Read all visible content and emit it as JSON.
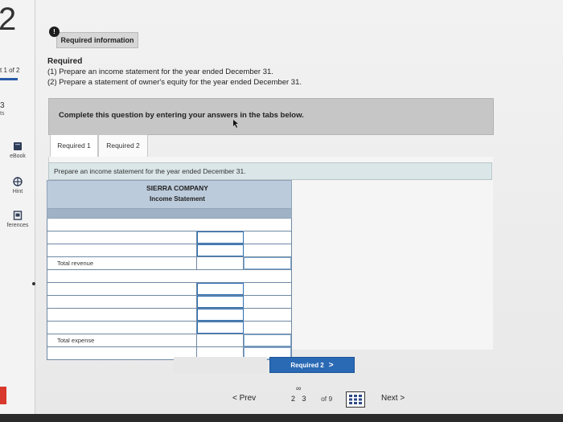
{
  "sidebar": {
    "question_number": "2",
    "part_label": "t 1 of 2",
    "points_value": "3",
    "points_label": "ts",
    "tools": [
      {
        "label": "eBook",
        "icon": "book-icon"
      },
      {
        "label": "Hint",
        "icon": "globe-icon"
      },
      {
        "label": "ferences",
        "icon": "reference-icon"
      }
    ]
  },
  "required_info": {
    "badge": "!",
    "label": "Required information"
  },
  "required": {
    "heading": "Required",
    "lines": [
      "(1) Prepare an income statement for the year ended December 31.",
      "(2) Prepare a statement of owner's equity for the year ended December 31."
    ]
  },
  "instruction": "Complete this question by entering your answers in the tabs below.",
  "tabs": [
    {
      "label": "Required 1",
      "active": true
    },
    {
      "label": "Required 2",
      "active": false
    }
  ],
  "tab_panel": {
    "prompt": "Prepare an income statement for the year ended December 31."
  },
  "statement": {
    "company": "SIERRA COMPANY",
    "title": "Income Statement",
    "total_revenue_label": "Total revenue",
    "total_expense_label": "Total expense"
  },
  "navigation": {
    "next_tab_label": "Required 2",
    "next_tab_chevron": ">",
    "prev_label": "Prev",
    "prev_chevron": "<",
    "pages": [
      "2",
      "3"
    ],
    "of_label": "of 9",
    "link_glyph": "∞",
    "next_label": "Next",
    "next_chevron": ">"
  },
  "colors": {
    "accent": "#2a69b4",
    "header_fill": "#bccbdb",
    "alert": "#d9382c"
  }
}
